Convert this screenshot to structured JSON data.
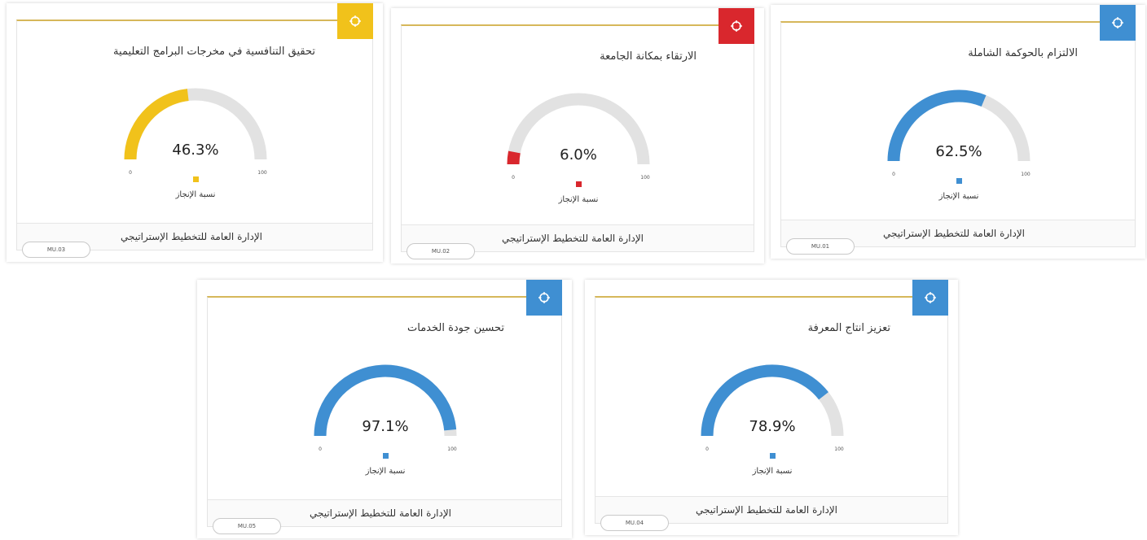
{
  "cards": [
    {
      "title": "تحقيق التنافسية في مخرجات البرامج التعليمية",
      "value_label": "46.3%",
      "progress": 0.463,
      "color": "#f1c21b",
      "legend": "نسبة الإنجاز",
      "footer": "الإدارة العامة للتخطيط الإستراتيجي",
      "code": "MU.03",
      "min_label": "0",
      "max_label": "100"
    },
    {
      "title": "الارتقاء بمكانة الجامعة",
      "value_label": "6.0%",
      "progress": 0.06,
      "color": "#d9272d",
      "legend": "نسبة الإنجاز",
      "footer": "الإدارة العامة للتخطيط الإستراتيجي",
      "code": "MU.02",
      "min_label": "0",
      "max_label": "100"
    },
    {
      "title": "الالتزام بالحوكمة الشاملة",
      "value_label": "62.5%",
      "progress": 0.625,
      "color": "#3f8fd2",
      "legend": "نسبة الإنجاز",
      "footer": "الإدارة العامة للتخطيط الإستراتيجي",
      "code": "MU.01",
      "min_label": "0",
      "max_label": "100"
    },
    {
      "title": "تحسين جودة الخدمات",
      "value_label": "97.1%",
      "progress": 0.971,
      "color": "#3f8fd2",
      "legend": "نسبة الإنجاز",
      "footer": "الإدارة العامة للتخطيط الإستراتيجي",
      "code": "MU.05",
      "min_label": "0",
      "max_label": "100"
    },
    {
      "title": "تعزيز انتاج المعرفة",
      "value_label": "78.9%",
      "progress": 0.789,
      "color": "#3f8fd2",
      "legend": "نسبة الإنجاز",
      "footer": "الإدارة العامة للتخطيط الإستراتيجي",
      "code": "MU.04",
      "min_label": "0",
      "max_label": "100"
    }
  ],
  "chart_data": [
    {
      "type": "gauge",
      "title": "تحقيق التنافسية في مخرجات البرامج التعليمية",
      "value": 46.3,
      "range": [
        0,
        100
      ],
      "series": [
        {
          "name": "نسبة الإنجاز",
          "values": [
            46.3
          ]
        }
      ],
      "color": "#f1c21b"
    },
    {
      "type": "gauge",
      "title": "الارتقاء بمكانة الجامعة",
      "value": 6.0,
      "range": [
        0,
        100
      ],
      "series": [
        {
          "name": "نسبة الإنجاز",
          "values": [
            6.0
          ]
        }
      ],
      "color": "#d9272d"
    },
    {
      "type": "gauge",
      "title": "الالتزام بالحوكمة الشاملة",
      "value": 62.5,
      "range": [
        0,
        100
      ],
      "series": [
        {
          "name": "نسبة الإنجاز",
          "values": [
            62.5
          ]
        }
      ],
      "color": "#3f8fd2"
    },
    {
      "type": "gauge",
      "title": "تحسين جودة الخدمات",
      "value": 97.1,
      "range": [
        0,
        100
      ],
      "series": [
        {
          "name": "نسبة الإنجاز",
          "values": [
            97.1
          ]
        }
      ],
      "color": "#3f8fd2"
    },
    {
      "type": "gauge",
      "title": "تعزيز انتاج المعرفة",
      "value": 78.9,
      "range": [
        0,
        100
      ],
      "series": [
        {
          "name": "نسبة الإنجاز",
          "values": [
            78.9
          ]
        }
      ],
      "color": "#3f8fd2"
    }
  ]
}
